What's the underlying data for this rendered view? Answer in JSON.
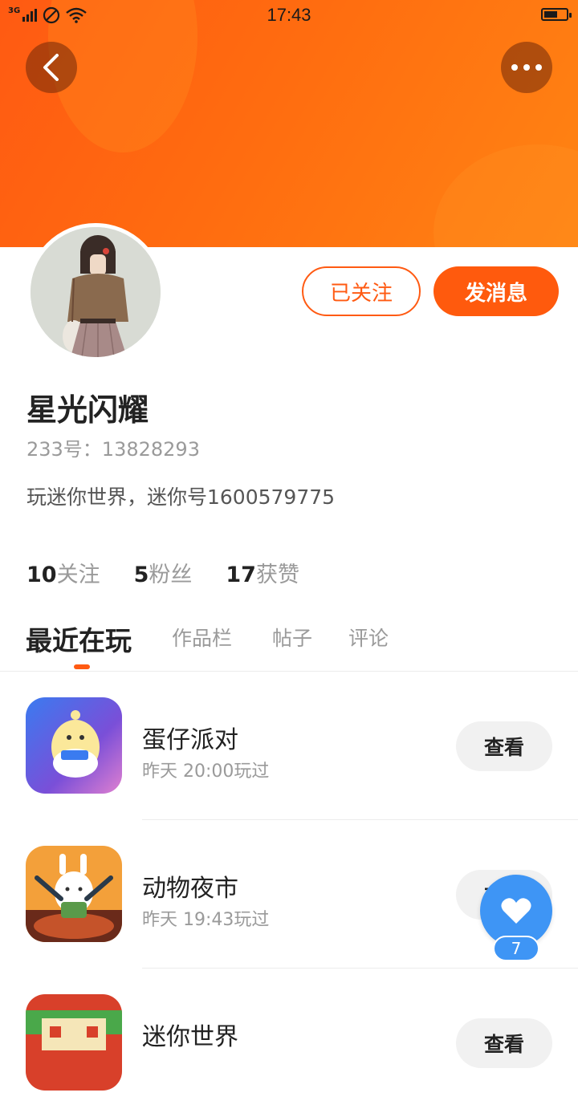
{
  "status_bar": {
    "network": "3G",
    "time": "17:43",
    "battery_level": 0.6
  },
  "header": {
    "back_icon": "chevron-left-icon",
    "more_icon": "more-horizontal-icon"
  },
  "profile": {
    "username": "星光闪耀",
    "user_id": "233号：13828293",
    "bio": "玩迷你世界，迷你号1600579775",
    "follow_button": "已关注",
    "message_button": "发消息",
    "stats": [
      {
        "num": "10",
        "label": "关注"
      },
      {
        "num": "5",
        "label": "粉丝"
      },
      {
        "num": "17",
        "label": "获赞"
      }
    ]
  },
  "tabs": [
    "最近在玩",
    "作品栏",
    "帖子",
    "评论"
  ],
  "games": [
    {
      "name": "蛋仔派对",
      "time": "昨天 20:00玩过",
      "button": "查看"
    },
    {
      "name": "动物夜市",
      "time": "昨天 19:43玩过",
      "button": "查看"
    },
    {
      "name": "迷你世界",
      "time": "",
      "button": "查看"
    }
  ],
  "fab": {
    "icon": "heart-icon",
    "count": "7"
  },
  "colors": {
    "accent": "#ff5a12",
    "fab_blue": "#3e95f5"
  }
}
